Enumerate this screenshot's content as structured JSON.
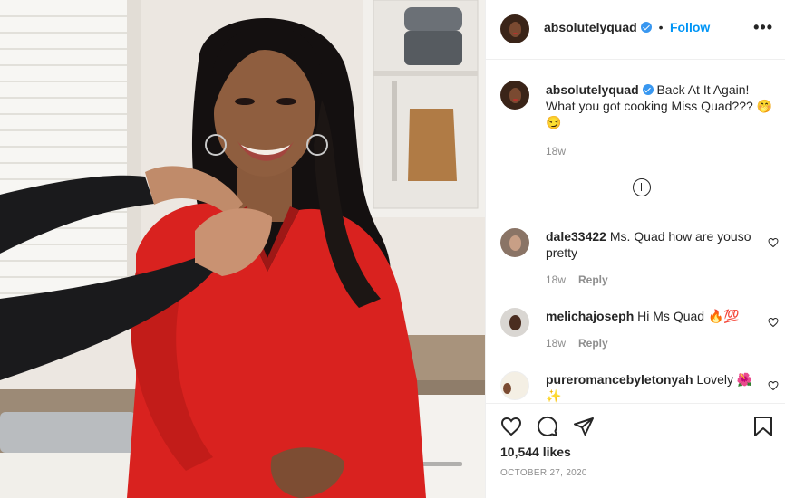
{
  "post": {
    "username": "absolutelyquad",
    "follow_label": "Follow",
    "separator": "•",
    "more_label": "•••",
    "caption_text": "Back At It Again! What you got cooking Miss Quad???",
    "caption_emoji": "🤭 😏",
    "caption_time": "18w",
    "likes": "10,544 likes",
    "date": "OCTOBER 27, 2020"
  },
  "comments": [
    {
      "username": "dale33422",
      "text": "Ms. Quad how are youso pretty",
      "emoji": "",
      "time": "18w",
      "reply": "Reply"
    },
    {
      "username": "melichajoseph",
      "text": "Hi Ms Quad",
      "emoji": "🔥💯",
      "time": "18w",
      "reply": "Reply"
    },
    {
      "username": "pureromancebyletonyah",
      "text": "Lovely",
      "emoji": "🌺✨",
      "time": "",
      "reply": ""
    }
  ],
  "icons": {
    "like": "heart-icon",
    "comment": "comment-icon",
    "share": "paper-plane-icon",
    "save": "bookmark-icon",
    "load_more": "plus-circle-icon",
    "options": "more-options-icon"
  },
  "colors": {
    "link": "#0095f6",
    "verified": "#3897f0",
    "muted": "#8e8e8e",
    "text": "#262626",
    "dress": "#d9221f"
  }
}
